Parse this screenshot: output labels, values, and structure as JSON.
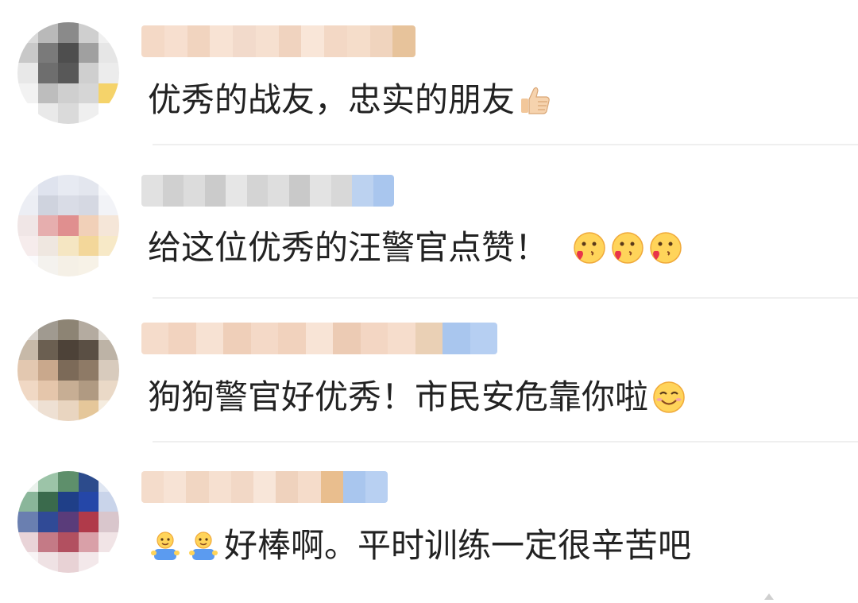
{
  "comments": [
    {
      "text": "优秀的战友，忠实的朋友",
      "trailing_icons": [
        "thumbs-up-icon"
      ],
      "avatar_colors": [
        "#d9d9d9",
        "#b9b9b9",
        "#8a8a8a",
        "#cfcfcf",
        "#f0f0f0",
        "#c8c8c8",
        "#7a7a7a",
        "#4e4e4e",
        "#a0a0a0",
        "#e6e6e6",
        "#e8e8e8",
        "#6e6e6e",
        "#585858",
        "#cfcfcf",
        "#ececec",
        "#f2f2f2",
        "#bdbdbd",
        "#cfcfcf",
        "#d6d6d6",
        "#f5d36a",
        "#ffffff",
        "#e9e9e9",
        "#dadada",
        "#efefef",
        "#ffffff"
      ],
      "name_colors": [
        "#f4d9c6",
        "#f7dfcf",
        "#f1d4bf",
        "#f8e3d4",
        "#f2dacb",
        "#f6e0d0",
        "#f0d3bf",
        "#f9e6d8",
        "#f3d8c5",
        "#f5ddca",
        "#f0d4be",
        "#e7c39b"
      ]
    },
    {
      "text": "给这位优秀的汪警官点赞！",
      "trailing_icons": [
        "kiss-heart-emoji-icon",
        "kiss-heart-emoji-icon",
        "kiss-heart-emoji-icon"
      ],
      "avatar_colors": [
        "#eef0f6",
        "#dfe3ee",
        "#e7eaf2",
        "#e3e6ee",
        "#f7f8fb",
        "#eceef4",
        "#cfd3de",
        "#d9dce6",
        "#d5d8e2",
        "#f2f3f7",
        "#f0e6e6",
        "#e6aeae",
        "#e08f8f",
        "#f1d0b8",
        "#f5e6d8",
        "#f6ecec",
        "#efe7e0",
        "#f5e6c2",
        "#f3d79a",
        "#f7e9c7",
        "#fbfbfd",
        "#f4f2ee",
        "#f5f0e6",
        "#f7f2e7",
        "#ffffff"
      ],
      "name_colors": [
        "#e1e1e1",
        "#d0d0d0",
        "#dcdcdc",
        "#cbcbcb",
        "#e6e6e6",
        "#d4d4d4",
        "#dedede",
        "#c9c9c9",
        "#e3e3e3",
        "#d8d8d8",
        "#bcd2f0",
        "#a9c6ee"
      ]
    },
    {
      "text": "狗狗警官好优秀！市民安危靠你啦",
      "trailing_icons": [
        "smile-emoji-icon"
      ],
      "avatar_colors": [
        "#d7d2cc",
        "#a09a90",
        "#8d8474",
        "#b4aba0",
        "#e2ddd6",
        "#c7b9a8",
        "#6b5f51",
        "#4d4238",
        "#5a4f44",
        "#bdb3a6",
        "#e3c8b0",
        "#c9a88c",
        "#7c6a58",
        "#8e7a66",
        "#d8cbbd",
        "#f0d8c4",
        "#e5c6ab",
        "#c7ae94",
        "#b09a82",
        "#ead9c7",
        "#f7efe8",
        "#eee0d3",
        "#e9d5c0",
        "#e5c79a",
        "#f5ecdf"
      ],
      "name_colors": [
        "#f5dccb",
        "#f2d3bf",
        "#f7e2d3",
        "#efcfb9",
        "#f4d9c7",
        "#f1d2bd",
        "#f8e4d6",
        "#eccbb4",
        "#f3d6c3",
        "#f6ddcc",
        "#ead0b5",
        "#a9c6ee",
        "#b6cff2"
      ]
    },
    {
      "text": "好棒啊。平时训练一定很辛苦吧",
      "leading_icons": [
        "worker-emoji-icon",
        "worker-emoji-icon"
      ],
      "avatar_colors": [
        "#eaf2ec",
        "#9cc4a8",
        "#5e8f6b",
        "#2c4b8c",
        "#dfe6f2",
        "#8ab69a",
        "#3a6a4c",
        "#1f3f88",
        "#2547a8",
        "#c9d4ea",
        "#6a7fb0",
        "#304a96",
        "#5a3c7a",
        "#b03a4a",
        "#d9c6cc",
        "#e9d4d8",
        "#c47a86",
        "#b25060",
        "#d9a0a8",
        "#f1e4e6",
        "#f8f4f5",
        "#efe2e4",
        "#e8d2d5",
        "#f3e8ea",
        "#ffffff"
      ],
      "name_colors": [
        "#f4dccb",
        "#f7e3d5",
        "#f1d6c2",
        "#f6e0d0",
        "#f2d8c6",
        "#f8e6d9",
        "#efd2bd",
        "#f5dcca",
        "#e9be8e",
        "#a9c6ee",
        "#b8d0f2"
      ]
    }
  ]
}
